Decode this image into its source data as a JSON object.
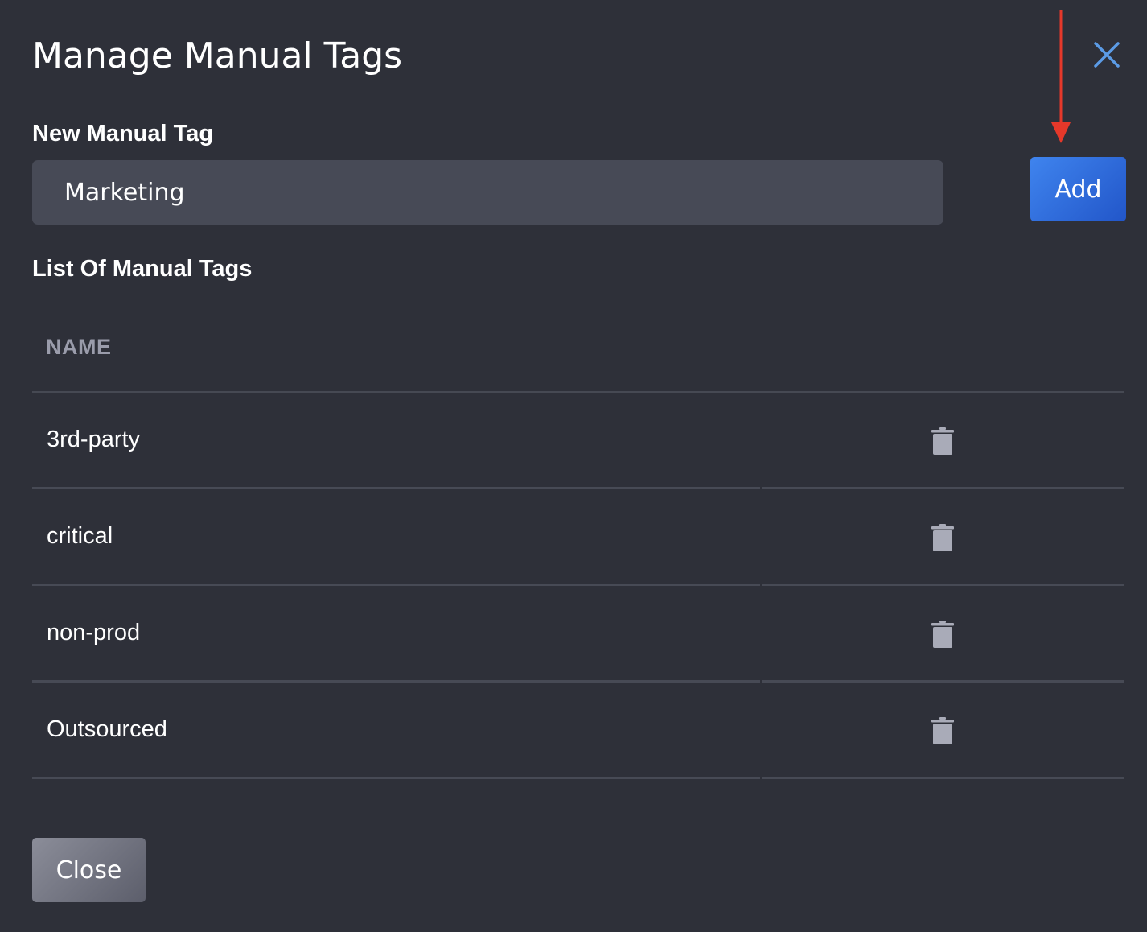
{
  "modal": {
    "title": "Manage Manual Tags"
  },
  "new_tag": {
    "label": "New Manual Tag",
    "input_value": "Marketing",
    "add_label": "Add"
  },
  "list": {
    "label": "List Of Manual Tags",
    "column_name": "NAME",
    "rows": [
      {
        "name": "3rd-party"
      },
      {
        "name": "critical"
      },
      {
        "name": "non-prod"
      },
      {
        "name": "Outsourced"
      }
    ]
  },
  "footer": {
    "close_label": "Close"
  },
  "icons": {
    "close": "close-icon",
    "delete": "trash-icon",
    "annotation": "arrow-down-icon"
  },
  "colors": {
    "background": "#2e3039",
    "input_bg": "#474a56",
    "accent": "#3b7fea",
    "close_x": "#5b9be6",
    "annotation": "#e5382a",
    "muted_text": "#9a9cab"
  }
}
